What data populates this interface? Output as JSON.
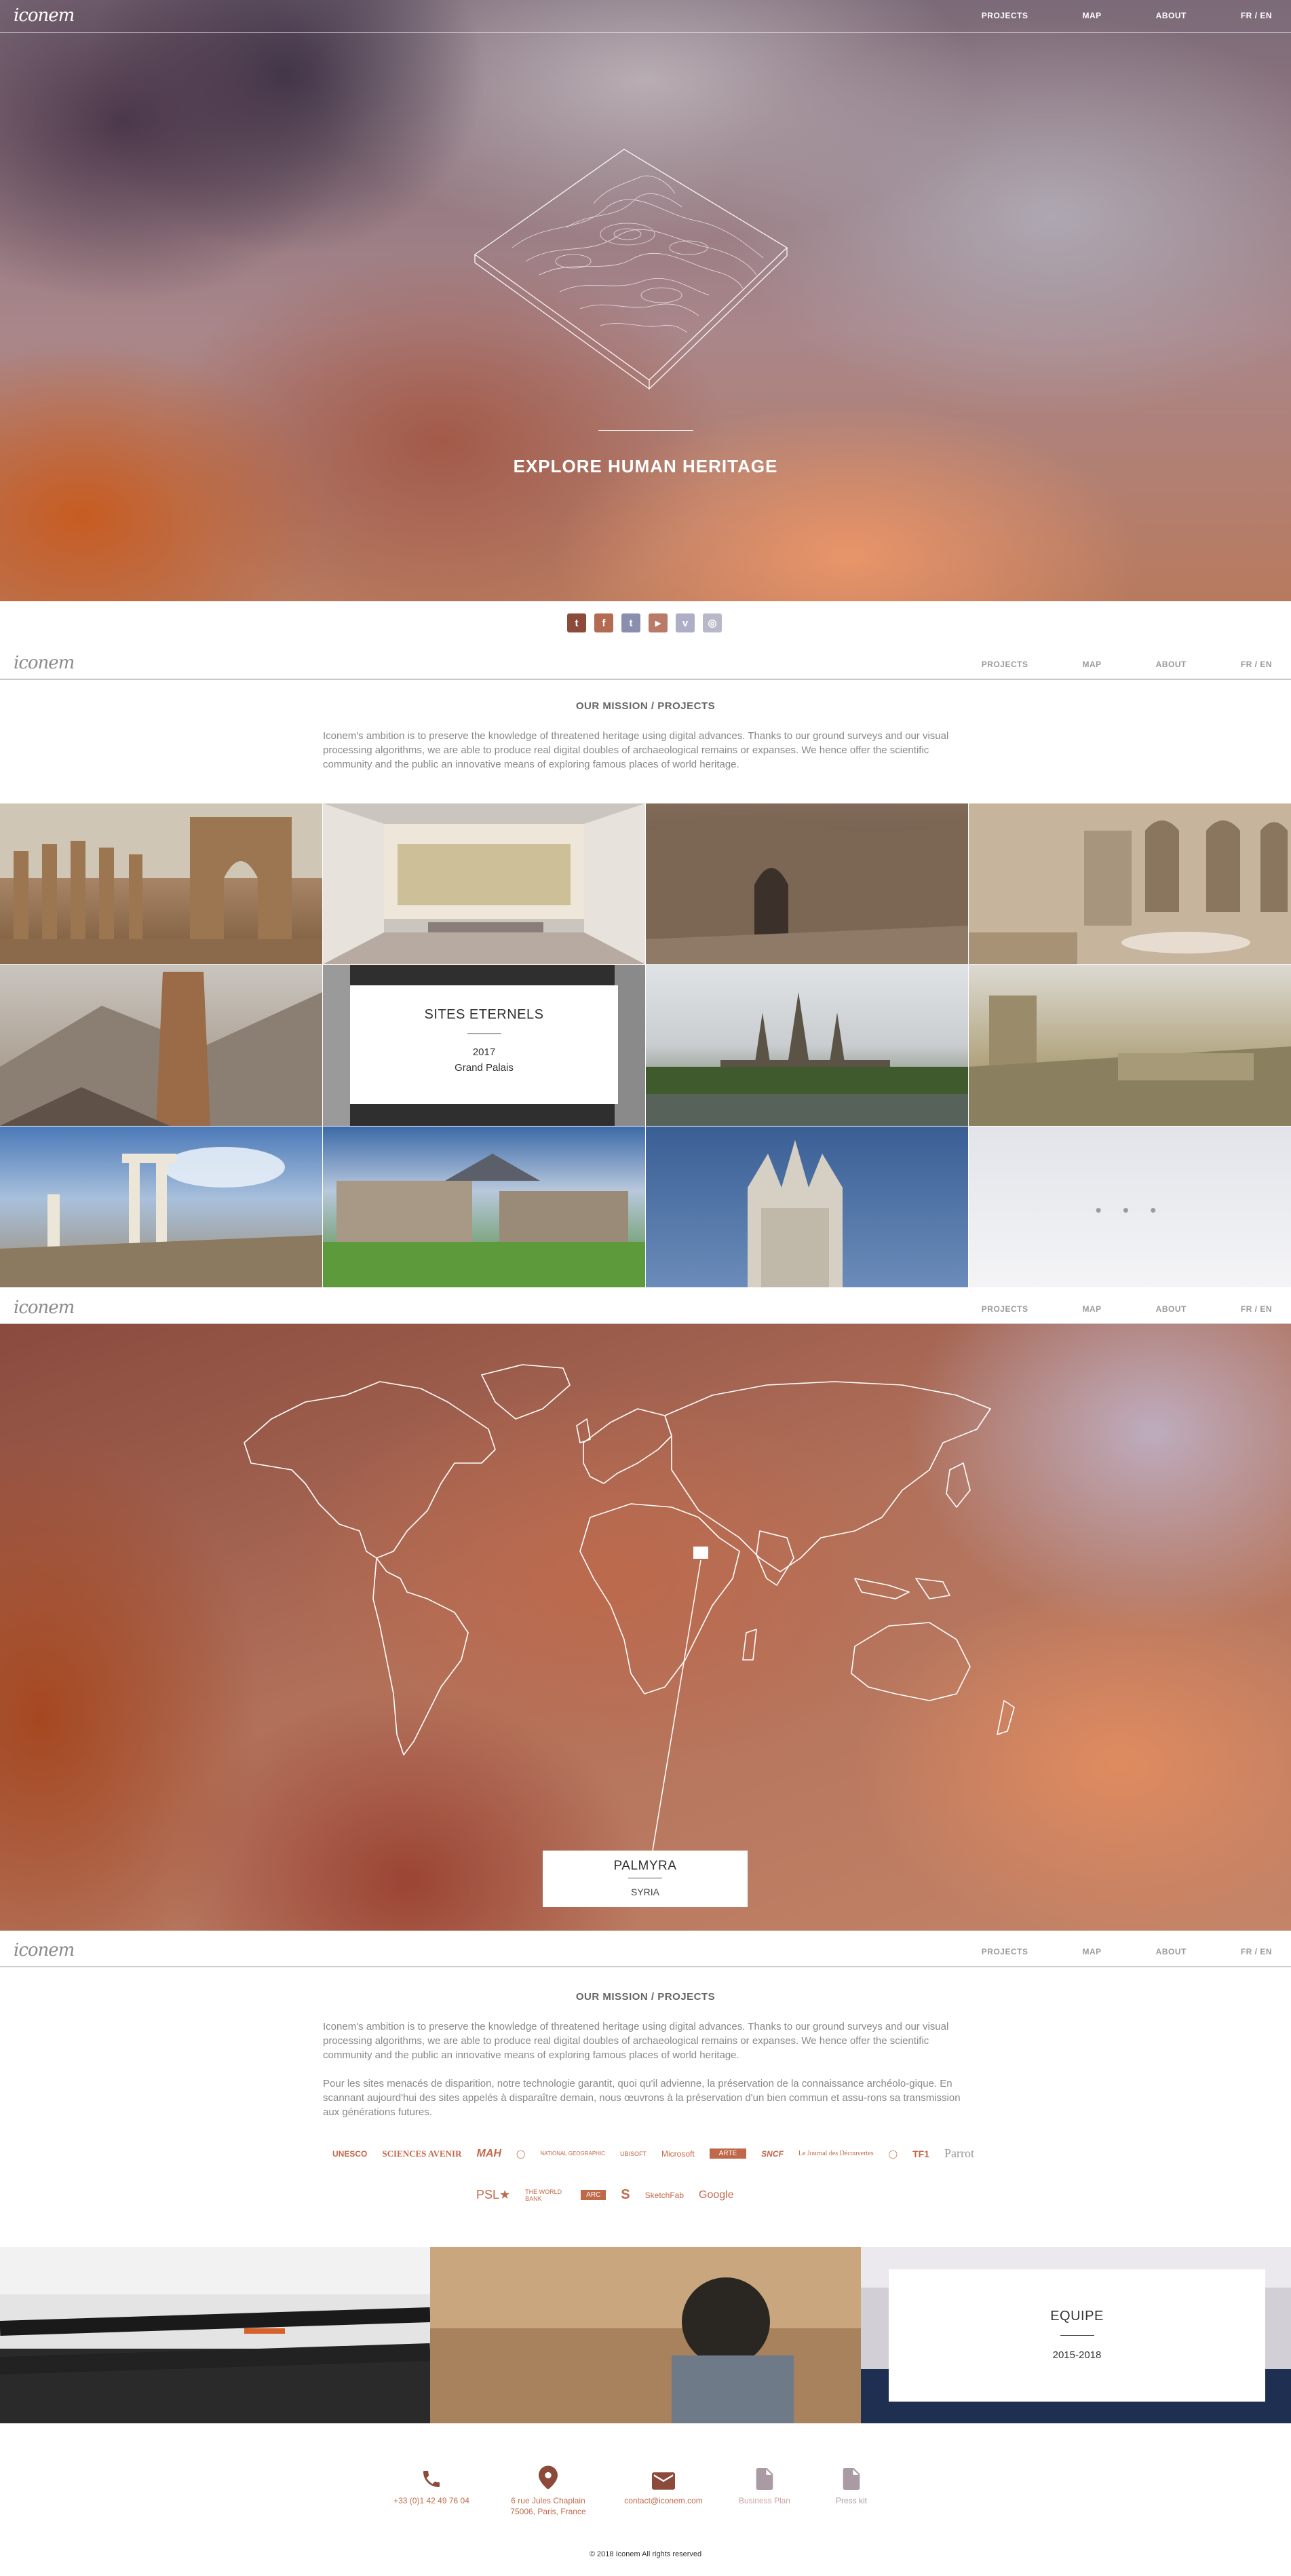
{
  "nav": {
    "logo": "iconem",
    "items": [
      "PROJECTS",
      "MAP",
      "ABOUT",
      "FR / EN"
    ]
  },
  "hero": {
    "headline": "EXPLORE HUMAN HERITAGE"
  },
  "social": {
    "icons": [
      "tumblr-icon",
      "facebook-icon",
      "twitter-icon",
      "youtube-icon",
      "vimeo-icon",
      "instagram-icon"
    ],
    "glyphs": [
      "t",
      "f",
      "t",
      "▶",
      "v",
      "◎"
    ],
    "colors": [
      "#8b4a3a",
      "#b56a52",
      "#8a8fb0",
      "#b97a68",
      "#aeaec6",
      "#b8b8c8"
    ]
  },
  "mission1": {
    "title": "OUR MISSION / PROJECTS",
    "text": "Iconem's ambition is to preserve the knowledge of threatened heritage using digital advances. Thanks to our ground surveys and our visual processing algorithms, we are able to produce real digital doubles of archaeological remains or expanses. We hence offer the scientific community and the public an innovative means of exploring famous places of world heritage."
  },
  "grid": {
    "featured": {
      "title": "SITES ETERNELS",
      "year": "2017",
      "place": "Grand Palais"
    },
    "more": "• • •"
  },
  "map": {
    "place": "PALMYRA",
    "country": "SYRIA"
  },
  "mission2": {
    "title": "OUR MISSION / PROJECTS",
    "text_en": "Iconem's ambition is to preserve the knowledge of threatened heritage using digital advances. Thanks to our ground surveys and our visual processing algorithms, we are able to produce real digital doubles of archaeological remains or expanses. We hence offer the scientific community and the public an innovative means of exploring famous places of world heritage.",
    "text_fr": "Pour les sites menacés de disparition, notre technologie garantit, quoi qu'il advienne, la préservation de la connaissance archéolo-gique. En scannant aujourd'hui des sites appelés à disparaître demain, nous œuvrons à la préservation d'un bien commun et assu-rons sa transmission aux générations futures."
  },
  "partners": {
    "row1": [
      "UNESCO",
      "SCIENCES AVENIR",
      "MAH",
      "◯",
      "NATIONAL GEOGRAPHIC",
      "UBISOFT",
      "Microsoft",
      "ARTE",
      "SNCF",
      "Le Journal des Découvertes",
      "◯",
      "TF1",
      "Parrot"
    ],
    "row2": [
      "PSL★",
      "THE WORLD BANK",
      "ARC",
      "S",
      "SketchFab",
      "Google"
    ]
  },
  "team": {
    "title": "EQUIPE",
    "years": "2015-2018"
  },
  "footer": {
    "phone": "+33 (0)1 42 49 76 04",
    "address1": "6 rue Jules Chaplain",
    "address2": "75006, Paris, France",
    "email": "contact@iconem.com",
    "business_plan": "Business Plan",
    "press_kit": "Press kit",
    "copyright": "© 2018 Iconem All rights reserved",
    "accent": "#c0694a",
    "muted": "#a99aa4"
  }
}
